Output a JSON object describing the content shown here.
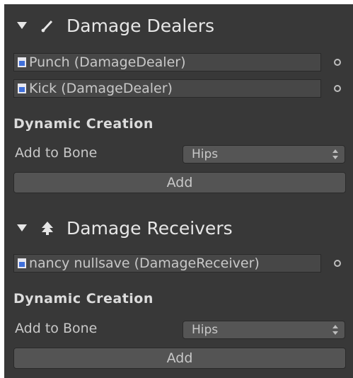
{
  "dealers": {
    "title": "Damage Dealers",
    "items": [
      {
        "label": "Punch (DamageDealer)"
      },
      {
        "label": "Kick (DamageDealer)"
      }
    ],
    "dynamic_heading": "Dynamic Creation",
    "bone_label": "Add to Bone",
    "bone_value": "Hips",
    "add_label": "Add"
  },
  "receivers": {
    "title": "Damage Receivers",
    "items": [
      {
        "label": "nancy nullsave (DamageReceiver)"
      }
    ],
    "dynamic_heading": "Dynamic Creation",
    "bone_label": "Add to Bone",
    "bone_value": "Hips",
    "add_label": "Add"
  },
  "icons": {
    "dealers": "brush-icon",
    "receivers": "tree-icon",
    "item": "script-file-icon",
    "picker": "object-picker-icon"
  },
  "colors": {
    "panel_background": "#383838",
    "field_background": "#474747",
    "button_background": "#545454",
    "text": "#c8c8c8"
  }
}
